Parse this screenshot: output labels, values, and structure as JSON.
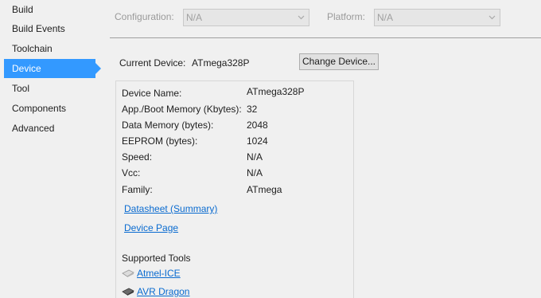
{
  "sidebar": {
    "items": [
      {
        "label": "Build"
      },
      {
        "label": "Build Events"
      },
      {
        "label": "Toolchain"
      },
      {
        "label": "Device"
      },
      {
        "label": "Tool"
      },
      {
        "label": "Components"
      },
      {
        "label": "Advanced"
      }
    ],
    "selected": "Device"
  },
  "config_bar": {
    "configuration_label": "Configuration:",
    "configuration_value": "N/A",
    "platform_label": "Platform:",
    "platform_value": "N/A"
  },
  "current_device": {
    "label": "Current Device:",
    "value": "ATmega328P",
    "change_button": "Change Device..."
  },
  "device_info": {
    "rows": [
      {
        "label": "Device Name:",
        "value": "ATmega328P"
      },
      {
        "label": "App./Boot Memory (Kbytes):",
        "value": "32"
      },
      {
        "label": "Data Memory (bytes):",
        "value": "2048"
      },
      {
        "label": "EEPROM (bytes):",
        "value": "1024"
      },
      {
        "label": "Speed:",
        "value": "N/A"
      },
      {
        "label": "Vcc:",
        "value": "N/A"
      },
      {
        "label": "Family:",
        "value": "ATmega"
      }
    ],
    "datasheet_link": "Datasheet (Summary)",
    "device_page_link": "Device Page",
    "supported_tools_title": "Supported Tools",
    "tools": [
      {
        "label": "Atmel-ICE",
        "icon": "atmel-ice-icon"
      },
      {
        "label": "AVR Dragon",
        "icon": "avr-dragon-icon"
      }
    ]
  },
  "colors": {
    "selected_bg": "#3399ff",
    "link": "#0a6bd0",
    "window_bg": "#f0f0f0"
  }
}
